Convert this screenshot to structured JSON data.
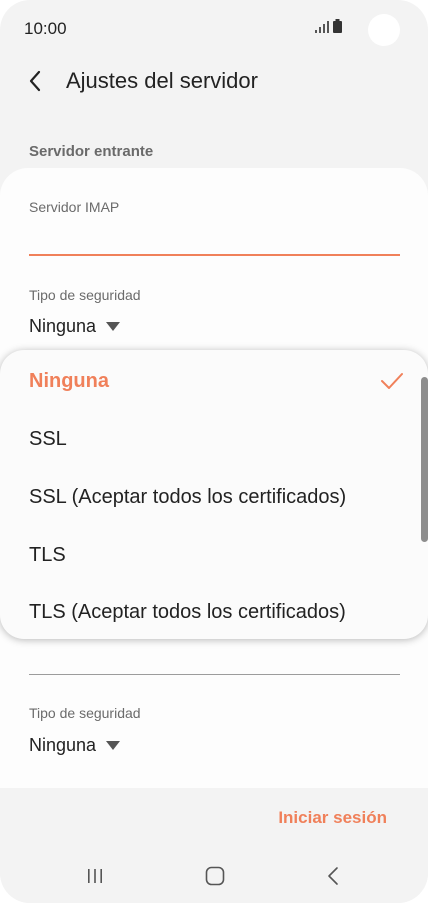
{
  "status_bar": {
    "time": "10:00",
    "icons": [
      "signal-icon",
      "battery-icon"
    ]
  },
  "header": {
    "title": "Ajustes del servidor",
    "back_icon": "chevron-left-icon"
  },
  "section": {
    "label": "Servidor entrante"
  },
  "form": {
    "imap_label": "Servidor IMAP",
    "imap_value": "",
    "security_label": "Tipo de seguridad",
    "security_value": "Ninguna",
    "security2_label": "Tipo de seguridad",
    "security2_value": "Ninguna"
  },
  "dropdown": {
    "options": [
      "Ninguna",
      "SSL",
      "SSL (Aceptar todos los certificados)",
      "TLS",
      "TLS (Aceptar todos los certificados)"
    ],
    "selected": "Ninguna"
  },
  "footer": {
    "login_label": "Iniciar sesión"
  },
  "nav": {
    "icons": [
      "recents-icon",
      "home-icon",
      "back-icon"
    ]
  },
  "colors": {
    "accent": "#f0805a",
    "background": "#f3f3f3",
    "card": "#fdfdfd"
  }
}
